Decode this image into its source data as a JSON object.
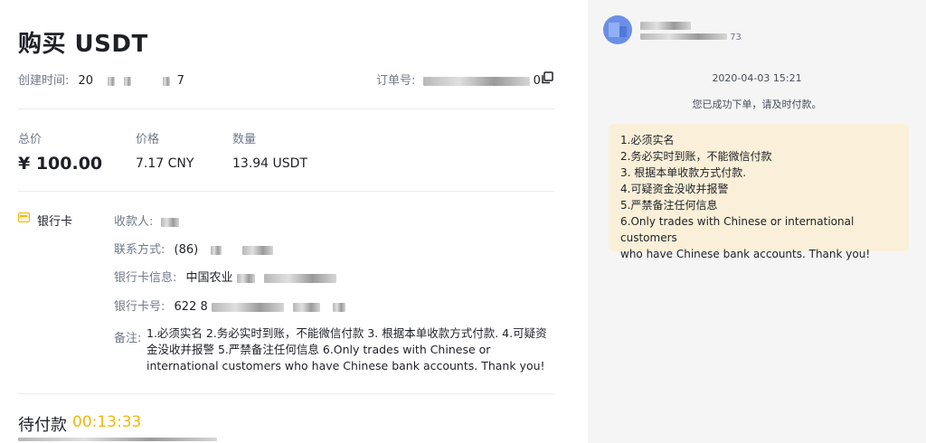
{
  "order": {
    "title": "购买 USDT",
    "created_label": "创建时间:",
    "created_value_prefix": "20",
    "created_value_suffix": "7",
    "order_no_label": "订单号:",
    "order_no_suffix": "0"
  },
  "summary": {
    "total_label": "总价",
    "total_value": "¥ 100.00",
    "price_label": "价格",
    "price_value": "7.17 CNY",
    "qty_label": "数量",
    "qty_value": "13.94 USDT"
  },
  "payment": {
    "method_label": "银行卡",
    "payee_label": "收款人:",
    "contact_label": "联系方式:",
    "contact_value": "(86)",
    "bank_info_label": "银行卡信息:",
    "bank_info_value": "中国农业",
    "card_no_label": "银行卡号:",
    "card_no_value": "622 8",
    "note_label": "备注:",
    "note_text": "1.必须实名 2.务必实时到账，不能微信付款 3. 根据本单收款方式付款. 4.可疑资金没收并报警 5.严禁备注任何信息 6.Only trades with Chinese or international customers who have Chinese bank accounts. Thank you!"
  },
  "status": {
    "title": "待付款",
    "timer": "00:13:33"
  },
  "chat": {
    "sub_suffix": "73",
    "timestamp": "2020-04-03 15:21",
    "system_message": "您已成功下单，请及时付款。",
    "message_lines": [
      "1.必须实名",
      "2.务必实时到账，不能微信付款",
      "3. 根据本单收款方式付款.",
      "4.可疑资金没收并报警",
      "5.严禁备注任何信息",
      "6.Only trades with Chinese or international customers",
      "who have Chinese bank accounts. Thank you!"
    ]
  },
  "colors": {
    "accent": "#f0b90b",
    "muted_text": "#707a8a",
    "chat_bubble": "#faf0d9",
    "chat_panel": "#f5f5f5"
  },
  "icons": {
    "copy": "copy-icon",
    "bank_card": "bank-card-icon",
    "avatar": "avatar"
  }
}
